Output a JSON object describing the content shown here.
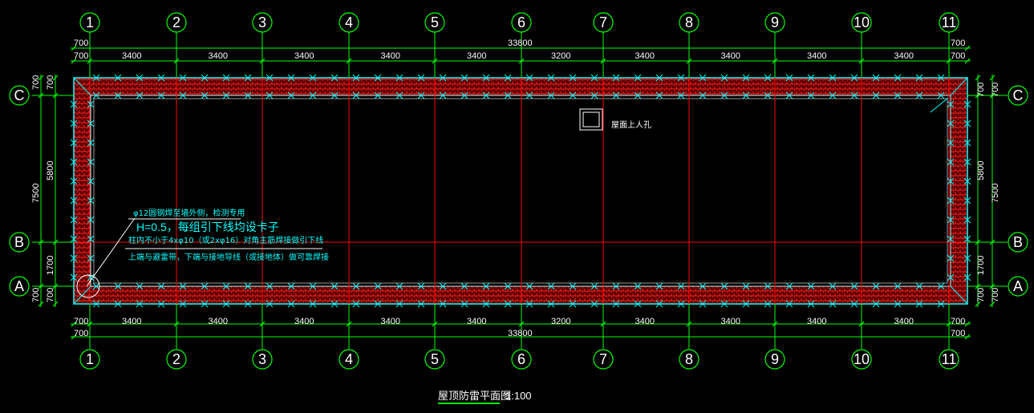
{
  "drawing": {
    "title": "屋顶防雷平面图",
    "scale": "1:100",
    "hatch_label": "屋面上人孔"
  },
  "grid_axes": {
    "columns": [
      "1",
      "2",
      "3",
      "4",
      "5",
      "6",
      "7",
      "8",
      "9",
      "10",
      "11"
    ],
    "rows": [
      "C",
      "B",
      "A"
    ]
  },
  "dimensions": {
    "top_total": "33800",
    "bottom_total": "33800",
    "edge": "700",
    "spans": [
      "3400",
      "3400",
      "3400",
      "3400",
      "3400",
      "3200",
      "3400",
      "3400",
      "3400",
      "3400"
    ],
    "left_outer": "7500",
    "left_inner": "5800",
    "left_small": "1700",
    "right_outer": "7500",
    "right_inner": "5800",
    "right_small": "1700"
  },
  "notes": {
    "line1": "φ12圆钢焊至墙外侧，检测专用",
    "line2": "H=0.5，每组引下线均设卡子",
    "line3": "柱内不小于4xφ10（或2xφ16）对角主筋焊接做引下线",
    "line4": "上端与避雷带，下端与接地导线（或接地体）做可靠焊接"
  },
  "colors": {
    "background": "#000000",
    "dimension_line": "#00ff00",
    "grid_line": "#ff0000",
    "lightning_belt": "#00ffff",
    "hatch": "#ff0000",
    "text": "#ffffff"
  }
}
